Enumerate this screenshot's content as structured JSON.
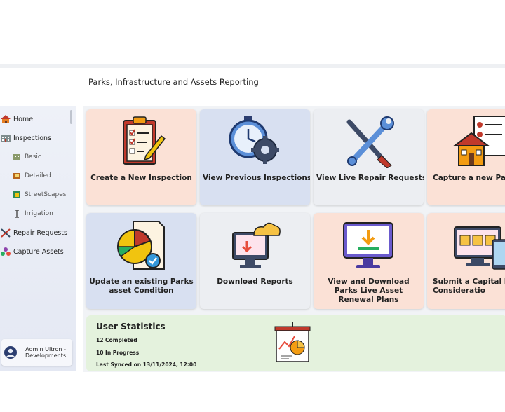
{
  "header": {
    "title": "Parks, Infrastructure and Assets Reporting"
  },
  "sidebar": {
    "items": [
      {
        "label": "Home",
        "icon": "home-icon"
      },
      {
        "label": "Inspections",
        "icon": "inspections-icon"
      },
      {
        "label": "Basic",
        "icon": "basic-icon"
      },
      {
        "label": "Detailed",
        "icon": "detailed-icon"
      },
      {
        "label": "StreetScapes",
        "icon": "streetscapes-icon"
      },
      {
        "label": "Irrigation",
        "icon": "irrigation-icon"
      },
      {
        "label": "Repair Requests",
        "icon": "repair-icon"
      },
      {
        "label": "Capture Assets",
        "icon": "capture-assets-icon"
      }
    ],
    "user": {
      "name": "Admin Ultron - Developments"
    }
  },
  "tiles": [
    {
      "label": "Create a New Inspection",
      "icon": "clipboard-checklist-icon",
      "color": "#fbe1d6"
    },
    {
      "label": "View Previous Inspections",
      "icon": "stopwatch-gear-icon",
      "color": "#d8e0f1"
    },
    {
      "label": "View Live Repair Requests",
      "icon": "wrench-screwdriver-icon",
      "color": "#eceef2"
    },
    {
      "label": "Capture a new Park",
      "icon": "house-document-icon",
      "color": "#fbe1d6"
    },
    {
      "label": "Update an existing Parks asset Condition",
      "icon": "pie-report-icon",
      "color": "#d8e0f1"
    },
    {
      "label": "Download Reports",
      "icon": "cloud-monitor-icon",
      "color": "#eceef2"
    },
    {
      "label": "View and Download Parks Live Asset Renewal Plans",
      "icon": "monitor-download-icon",
      "color": "#fbe1d6"
    },
    {
      "label": "Submit a Capital Re for Consideratio",
      "icon": "monitor-phone-icon",
      "color": "#fbe1d6"
    }
  ],
  "stats": {
    "title": "User Statistics",
    "completed": "12 Completed",
    "in_progress": "10 In Progress",
    "last_synced": "Last Synced on 13/11/2024, 12:00",
    "icon": "presentation-chart-icon"
  }
}
